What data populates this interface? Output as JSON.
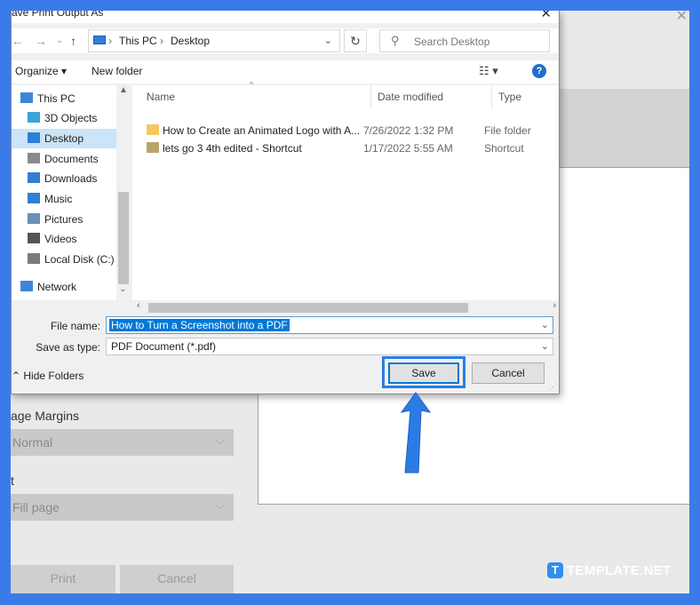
{
  "dialog": {
    "title": "ave Print Output As",
    "close_glyph": "✕"
  },
  "address": {
    "crumbs": [
      "This PC",
      "Desktop"
    ],
    "separator": "›",
    "search_placeholder": "Search Desktop"
  },
  "toolbar": {
    "organize_label": "Organize ▾",
    "new_folder_label": "New folder",
    "view_label": "☷ ▾",
    "help_label": "?"
  },
  "nav_pane": {
    "items": [
      {
        "label": "This PC",
        "icon": "computer-icon"
      },
      {
        "label": "3D Objects",
        "icon": "cube-icon"
      },
      {
        "label": "Desktop",
        "icon": "desktop-icon",
        "selected": true
      },
      {
        "label": "Documents",
        "icon": "document-icon"
      },
      {
        "label": "Downloads",
        "icon": "download-icon"
      },
      {
        "label": "Music",
        "icon": "music-icon"
      },
      {
        "label": "Pictures",
        "icon": "picture-icon"
      },
      {
        "label": "Videos",
        "icon": "video-icon"
      },
      {
        "label": "Local Disk (C:)",
        "icon": "disk-icon"
      },
      {
        "label": "Network",
        "icon": "network-icon"
      }
    ]
  },
  "file_list": {
    "columns": [
      "Name",
      "Date modified",
      "Type"
    ],
    "rows": [
      {
        "name": "How to Create an Animated Logo with A...",
        "date": "7/26/2022 1:32 PM",
        "type": "File folder",
        "icon": "folder-icon"
      },
      {
        "name": "lets go 3 4th edited - Shortcut",
        "date": "1/17/2022 5:55 AM",
        "type": "Shortcut",
        "icon": "shortcut-icon"
      }
    ]
  },
  "form": {
    "file_name_label": "File name:",
    "file_name_value": "How to Turn a Screenshot into a PDF",
    "save_type_label": "Save as type:",
    "save_type_value": "PDF Document (*.pdf)"
  },
  "footer": {
    "hide_folders_label": "Hide Folders",
    "save_label": "Save",
    "cancel_label": "Cancel"
  },
  "background": {
    "margins_label": "age Margins",
    "margins_value": "Normal",
    "scale_label": "t",
    "scale_value": "Fill page",
    "print_label": "Print",
    "cancel_label": "Cancel",
    "close_glyph": "✕"
  },
  "watermark": {
    "logo_letter": "T",
    "text": "TEMPLATE.NET"
  },
  "colors": {
    "page_border": "#3b7be8",
    "accent": "#0078d7",
    "highlight": "#2c7be5"
  }
}
